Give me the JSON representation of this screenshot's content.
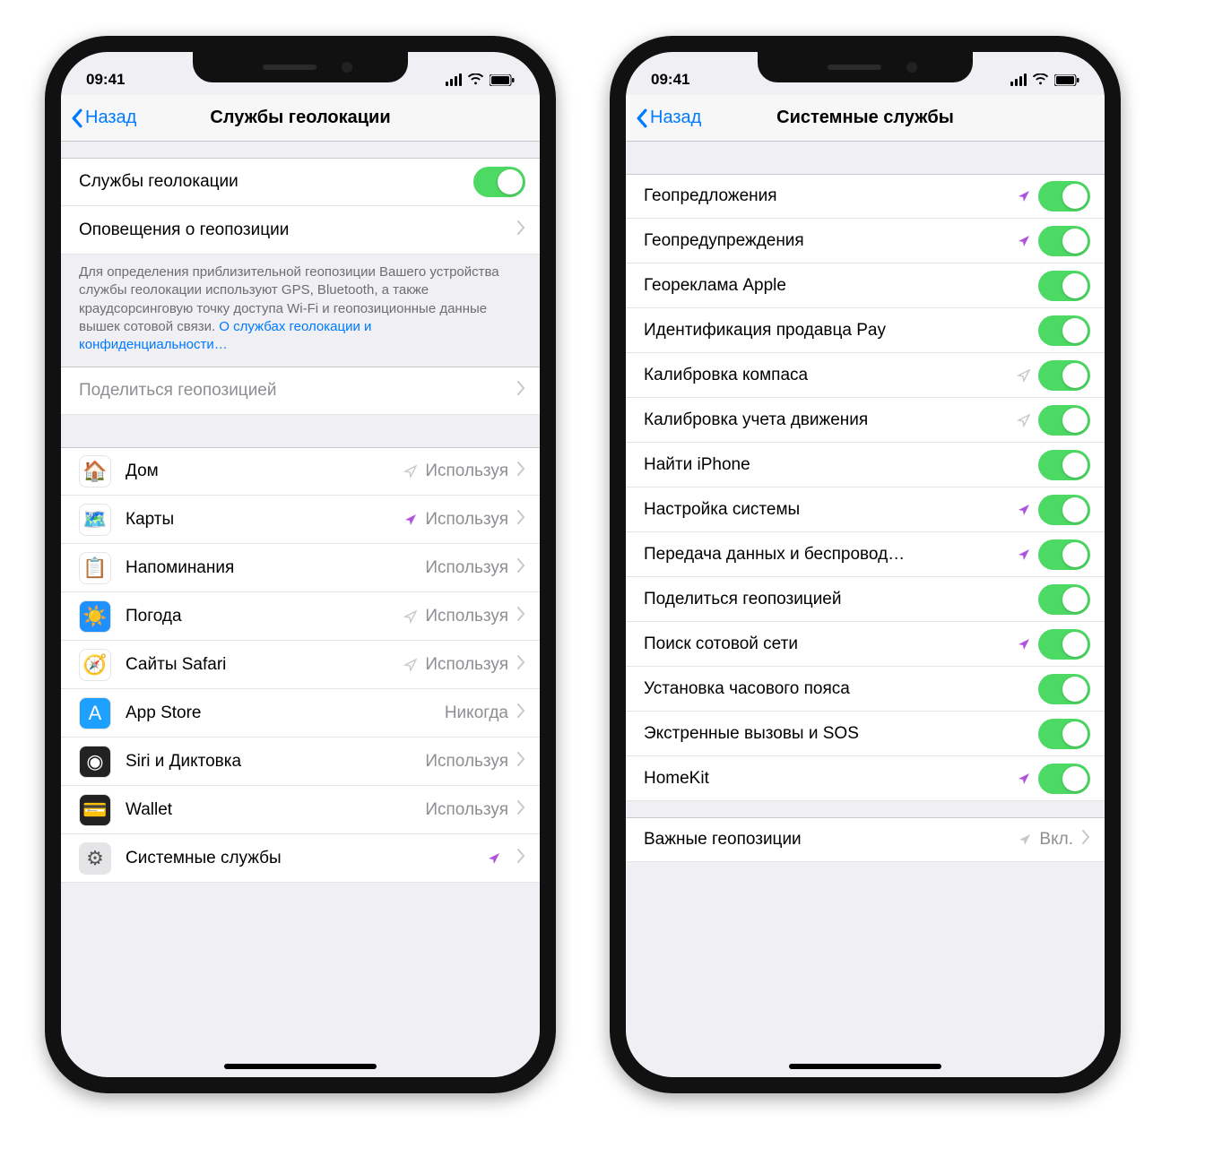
{
  "status": {
    "time": "09:41"
  },
  "left": {
    "back": "Назад",
    "title": "Службы геолокации",
    "toggle_label": "Службы геолокации",
    "alerts_label": "Оповещения о геопозиции",
    "footer_text": "Для определения приблизительной геопозиции Вашего устройства службы геолокации используют GPS, Bluetooth, а также краудсорсинговую точку доступа Wi-Fi и геопозиционные данные вышек сотовой связи. ",
    "footer_link": "О службах геолокации и конфиденциальности…",
    "share_label": "Поделиться геопозицией",
    "apps": [
      {
        "name": "Дом",
        "detail": "Используя",
        "arrow": "gray",
        "icon_bg": "#fff",
        "icon": "🏠"
      },
      {
        "name": "Карты",
        "detail": "Используя",
        "arrow": "purple",
        "icon_bg": "#fff",
        "icon": "🗺️"
      },
      {
        "name": "Напоминания",
        "detail": "Используя",
        "arrow": "none",
        "icon_bg": "#fff",
        "icon": "📋"
      },
      {
        "name": "Погода",
        "detail": "Используя",
        "arrow": "gray",
        "icon_bg": "#1e90ff",
        "icon": "☀️"
      },
      {
        "name": "Сайты Safari",
        "detail": "Используя",
        "arrow": "gray",
        "icon_bg": "#fff",
        "icon": "🧭"
      },
      {
        "name": "App Store",
        "detail": "Никогда",
        "arrow": "none",
        "icon_bg": "#1ea0ff",
        "icon": "A"
      },
      {
        "name": "Siri и Диктовка",
        "detail": "Используя",
        "arrow": "none",
        "icon_bg": "#222",
        "icon": "◉"
      },
      {
        "name": "Wallet",
        "detail": "Используя",
        "arrow": "none",
        "icon_bg": "#222",
        "icon": "💳"
      }
    ],
    "system_label": "Системные службы"
  },
  "right": {
    "back": "Назад",
    "title": "Системные службы",
    "items": [
      {
        "name": "Геопредложения",
        "arrow": "purple",
        "toggle": true
      },
      {
        "name": "Геопредупреждения",
        "arrow": "purple",
        "toggle": true
      },
      {
        "name": "Геореклама Apple",
        "arrow": "none",
        "toggle": true
      },
      {
        "name": "Идентификация продавца Pay",
        "arrow": "none",
        "toggle": true
      },
      {
        "name": "Калибровка компаса",
        "arrow": "gray",
        "toggle": true
      },
      {
        "name": "Калибровка учета движения",
        "arrow": "gray",
        "toggle": true
      },
      {
        "name": "Найти iPhone",
        "arrow": "none",
        "toggle": true
      },
      {
        "name": "Настройка системы",
        "arrow": "purple",
        "toggle": true
      },
      {
        "name": "Передача данных и беспровод…",
        "arrow": "purple",
        "toggle": true
      },
      {
        "name": "Поделиться геопозицией",
        "arrow": "none",
        "toggle": true
      },
      {
        "name": "Поиск сотовой сети",
        "arrow": "purple",
        "toggle": true
      },
      {
        "name": "Установка часового пояса",
        "arrow": "none",
        "toggle": true
      },
      {
        "name": "Экстренные вызовы и SOS",
        "arrow": "none",
        "toggle": true
      },
      {
        "name": "HomeKit",
        "arrow": "purple",
        "toggle": true
      }
    ],
    "significant_label": "Важные геопозиции",
    "significant_detail": "Вкл."
  }
}
